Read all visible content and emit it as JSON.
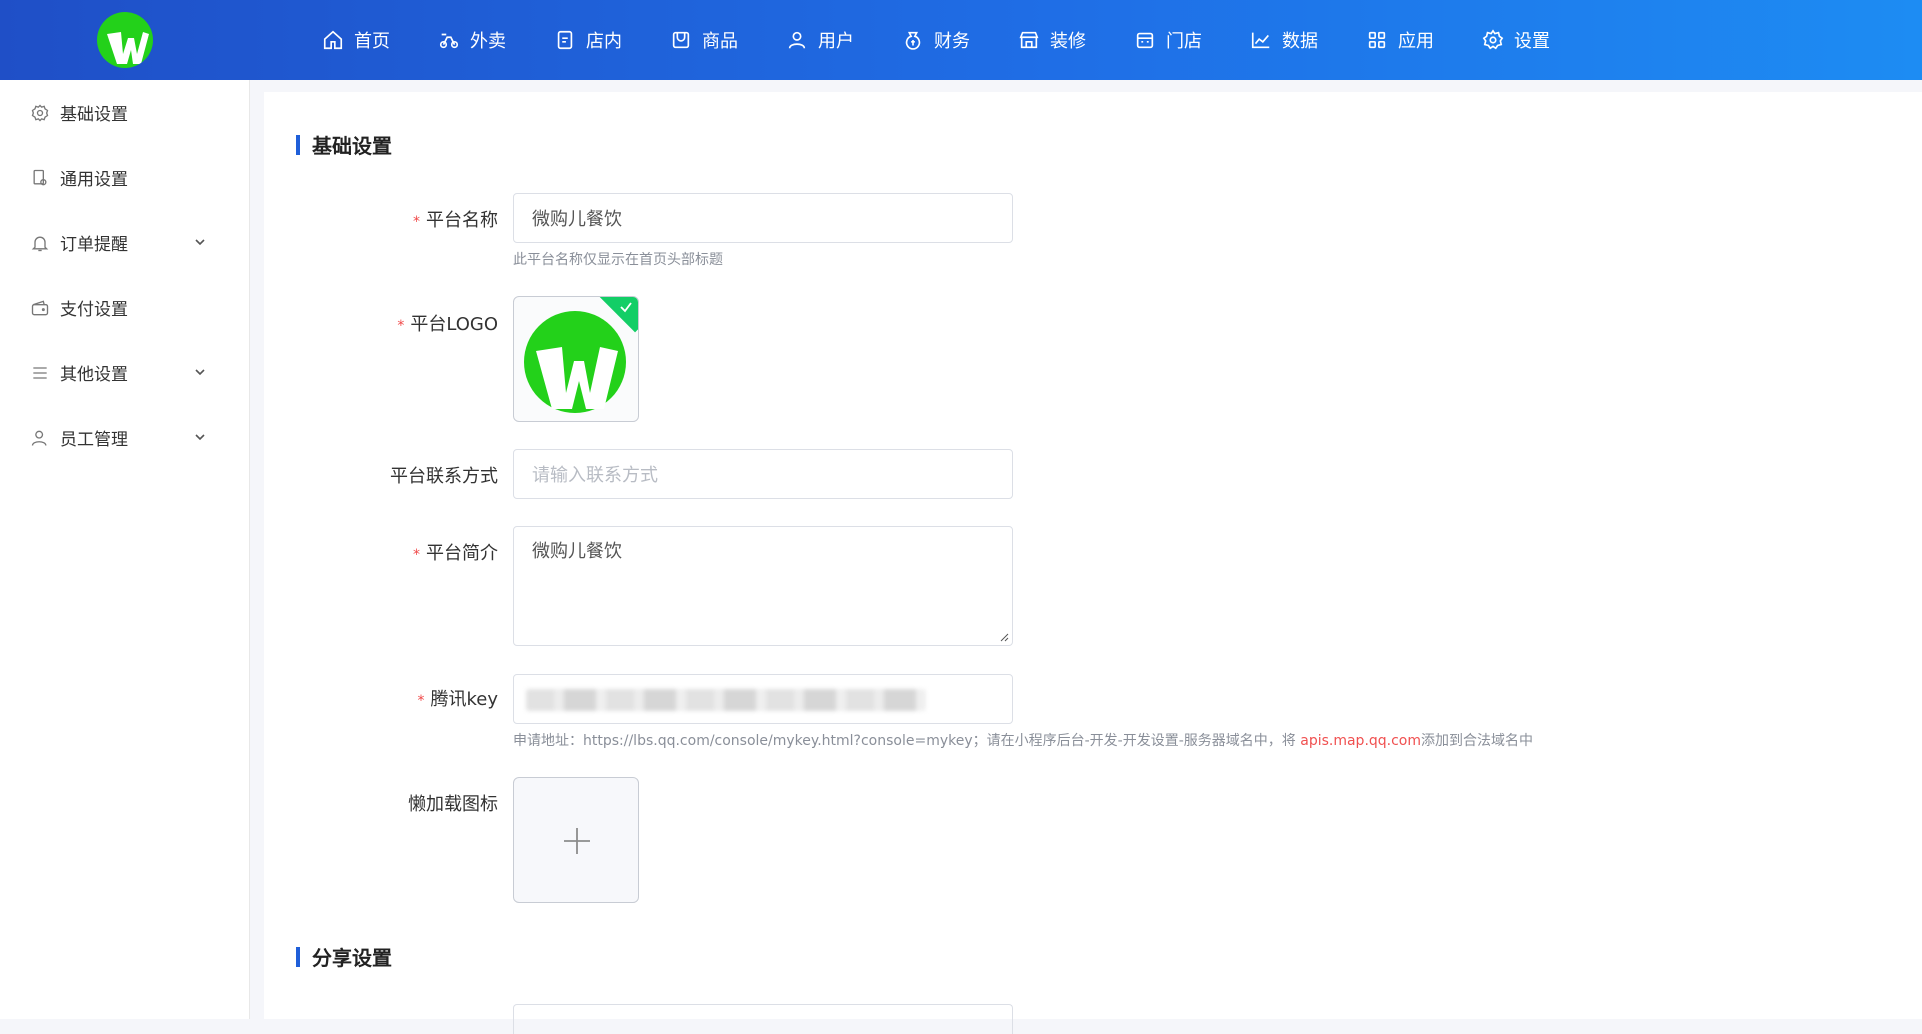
{
  "header": {
    "nav": [
      {
        "label": "首页",
        "icon": "home-icon"
      },
      {
        "label": "外卖",
        "icon": "delivery-icon"
      },
      {
        "label": "店内",
        "icon": "dine-in-icon"
      },
      {
        "label": "商品",
        "icon": "goods-icon"
      },
      {
        "label": "用户",
        "icon": "user-icon"
      },
      {
        "label": "财务",
        "icon": "finance-icon"
      },
      {
        "label": "装修",
        "icon": "decoration-icon"
      },
      {
        "label": "门店",
        "icon": "store-icon"
      },
      {
        "label": "数据",
        "icon": "data-icon"
      },
      {
        "label": "应用",
        "icon": "apps-icon"
      },
      {
        "label": "设置",
        "icon": "settings-icon"
      }
    ]
  },
  "sidebar": {
    "items": [
      {
        "label": "基础设置",
        "icon": "gear-icon",
        "expandable": false
      },
      {
        "label": "通用设置",
        "icon": "general-icon",
        "expandable": false
      },
      {
        "label": "订单提醒",
        "icon": "bell-icon",
        "expandable": true
      },
      {
        "label": "支付设置",
        "icon": "wallet-icon",
        "expandable": false
      },
      {
        "label": "其他设置",
        "icon": "list-icon",
        "expandable": true
      },
      {
        "label": "员工管理",
        "icon": "staff-icon",
        "expandable": true
      }
    ]
  },
  "form": {
    "section_basic": "基础设置",
    "section_share": "分享设置",
    "platform_name": {
      "label": "平台名称",
      "value": "微购儿餐饮",
      "hint": "此平台名称仅显示在首页头部标题"
    },
    "platform_logo": {
      "label": "平台LOGO"
    },
    "platform_contact": {
      "label": "平台联系方式",
      "placeholder": "请输入联系方式"
    },
    "platform_intro": {
      "label": "平台简介",
      "value": "微购儿餐饮"
    },
    "tencent_key": {
      "label": "腾讯key",
      "hint_prefix": "申请地址：https://lbs.qq.com/console/mykey.html?console=mykey；请在小程序后台-开发-开发设置-服务器域名中，将 ",
      "hint_link": "apis.map.qq.com",
      "hint_suffix": "添加到合法域名中"
    },
    "lazy_icon": {
      "label": "懒加载图标"
    }
  },
  "colors": {
    "accent": "#1f5fd9",
    "required": "#f04848",
    "logo_green": "#23d11a",
    "check_green": "#13ce66"
  }
}
